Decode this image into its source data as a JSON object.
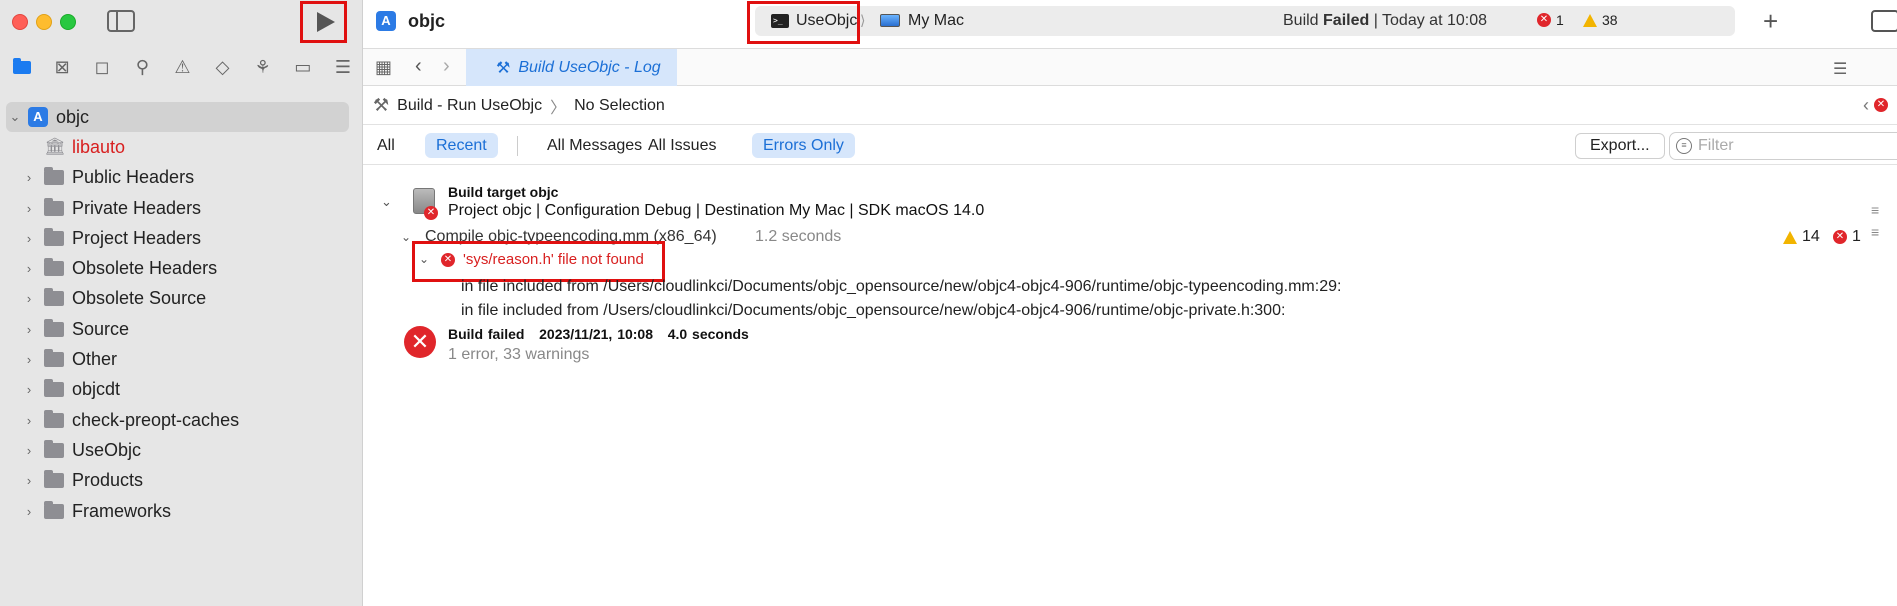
{
  "window": {
    "project_name": "objc",
    "scheme": "UseObjc",
    "destination": "My Mac",
    "build_status_prefix": "Build ",
    "build_status_strong": "Failed",
    "build_status_suffix": " | Today at 10:08",
    "error_count": "1",
    "warning_count": "38",
    "add_symbol": "+"
  },
  "navigator": {
    "project": "objc",
    "items": [
      {
        "label": "libauto",
        "type": "library"
      },
      {
        "label": "Public Headers",
        "type": "folder"
      },
      {
        "label": "Private Headers",
        "type": "folder"
      },
      {
        "label": "Project Headers",
        "type": "folder"
      },
      {
        "label": "Obsolete Headers",
        "type": "folder"
      },
      {
        "label": "Obsolete Source",
        "type": "folder"
      },
      {
        "label": "Source",
        "type": "folder"
      },
      {
        "label": "Other",
        "type": "folder"
      },
      {
        "label": "objcdt",
        "type": "folder"
      },
      {
        "label": "check-preopt-caches",
        "type": "folder"
      },
      {
        "label": "UseObjc",
        "type": "folder"
      },
      {
        "label": "Products",
        "type": "folder"
      },
      {
        "label": "Frameworks",
        "type": "folder"
      }
    ]
  },
  "editor": {
    "tab_title": "Build UseObjc - Log",
    "breadcrumb": [
      "Build - Run UseObjc",
      "No Selection"
    ]
  },
  "filters": {
    "all": "All",
    "recent": "Recent",
    "all_messages": "All Messages",
    "all_issues": "All Issues",
    "errors_only": "Errors Only",
    "export": "Export...",
    "filter_placeholder": "Filter"
  },
  "log": {
    "target_title": "Build target objc",
    "target_detail": "Project objc | Configuration Debug | Destination My Mac | SDK macOS 14.0",
    "compile_step": "Compile objc-typeencoding.mm (x86_64)",
    "compile_time": "1.2 seconds",
    "step_warnings": "14",
    "step_errors": "1",
    "issue": "'sys/reason.h' file not found",
    "include_lines": [
      "in file included from /Users/cloudlinkci/Documents/objc_opensource/new/objc4-objc4-906/runtime/objc-typeencoding.mm:29:",
      "in file included from /Users/cloudlinkci/Documents/objc_opensource/new/objc4-objc4-906/runtime/objc-private.h:300:"
    ],
    "result_title": "Build failed",
    "result_date": "2023/11/21, 10:08",
    "result_duration": "4.0 seconds",
    "result_summary": "1 error, 33 warnings"
  },
  "colors": {
    "accent": "#1b6fd6",
    "error": "#e0262b",
    "warning": "#f2b400",
    "highlight_box": "#e01010"
  }
}
